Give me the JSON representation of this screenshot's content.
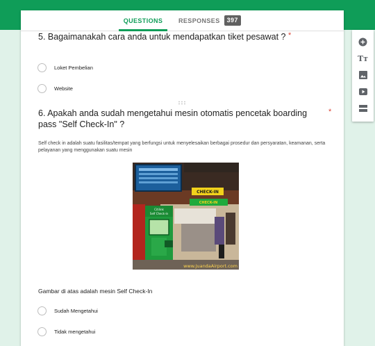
{
  "tabs": {
    "questions_label": "QUESTIONS",
    "responses_label": "RESPONSES",
    "responses_count": "397"
  },
  "question5": {
    "title": "5. Bagaimanakah cara anda untuk mendapatkan tiket pesawat ?",
    "required_mark": "*",
    "options": [
      "Loket Pembelian",
      "Website"
    ]
  },
  "question6": {
    "title": "6. Apakah anda sudah mengetahui mesin otomatis pencetak boarding pass \"Self Check-In\" ?",
    "required_mark": "*",
    "description": "Self check in adalah suatu fasilitas/tempat yang berfungsi untuk menyelesaikan berbagai prosedur dan persyaratan, keamanan, serta pelayanan yang menggunakan suatu mesin",
    "image_sign_top": "CHECK-IN",
    "image_sign_bottom": "CHECK-IN",
    "image_kiosk_brand": "Citilink",
    "image_kiosk_label": "Self Check-in",
    "image_watermark": "www.JuandaAirport.com",
    "image_caption": "Gambar di atas adalah mesin Self Check-In",
    "options": [
      "Sudah Mengetahui",
      "Tidak mengetahui"
    ]
  },
  "toolbar": {
    "icons": [
      "add-question-icon",
      "title-text-icon",
      "image-icon",
      "video-icon",
      "section-icon"
    ],
    "text_icon_glyph": "Tт"
  },
  "colors": {
    "brand_green": "#0f9d58",
    "background": "#e0f2e9",
    "required_red": "#db4437",
    "badge_grey": "#616161"
  }
}
